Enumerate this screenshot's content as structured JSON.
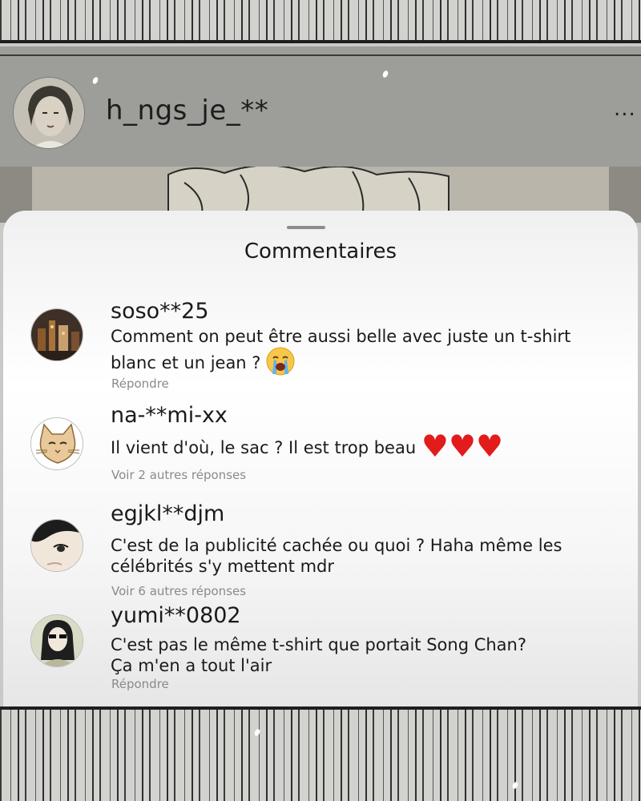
{
  "post": {
    "username": "h_ngs_je_**",
    "more_icon": "..."
  },
  "sheet": {
    "title": "Commentaires"
  },
  "comments": [
    {
      "user": "soso**25",
      "text": "Comment on peut être aussi belle avec juste un t-shirt blanc et un jean ?",
      "emoji": "crying-face-emoji",
      "action": "Répondre"
    },
    {
      "user": "na-**mi-xx",
      "text": "Il vient d'où, le sac ? Il est trop beau",
      "emoji": "three-red-hearts",
      "action": "Voir 2 autres réponses"
    },
    {
      "user": "egjkl**djm",
      "text": "C'est de la publicité cachée ou quoi ? Haha même les célébrités s'y mettent mdr",
      "action": "Voir 6 autres réponses"
    },
    {
      "user": "yumi**0802",
      "text_line1": "C'est pas le même t-shirt que portait Song Chan?",
      "text_line2": "Ça m'en a tout l'air",
      "action": "Répondre"
    }
  ],
  "colors": {
    "heart": "#e21b1b",
    "action_text": "#8a8a8a",
    "header_bg": "#9d9d99"
  }
}
